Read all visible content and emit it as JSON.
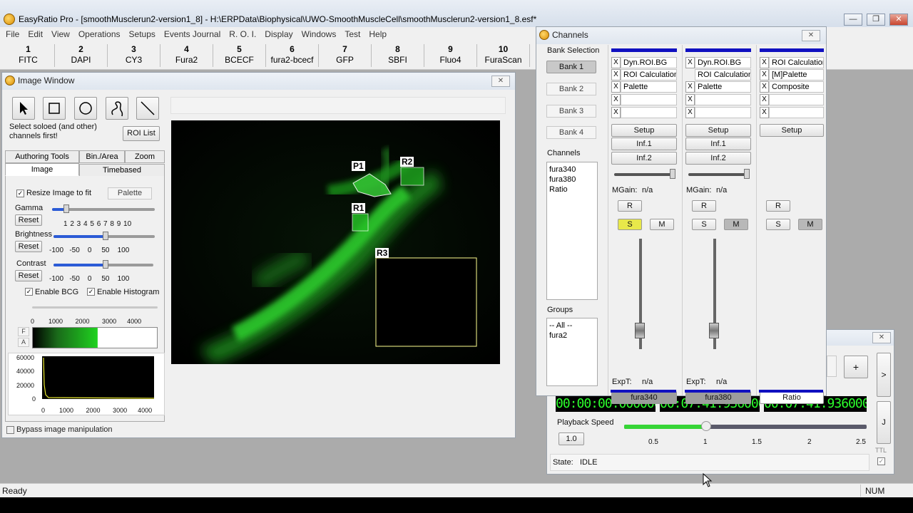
{
  "app": {
    "title": "EasyRatio Pro - [smoothMusclerun2-version1_8] - H:\\ERPData\\Biophysical\\UWO-SmoothMuscleCell\\smoothMusclerun2-version1_8.esf*",
    "window_controls": [
      "—",
      "❐",
      "✕"
    ]
  },
  "menu": [
    "File",
    "Edit",
    "View",
    "Operations",
    "Setups",
    "Events Journal",
    "R. O. I.",
    "Display",
    "Windows",
    "Test",
    "Help"
  ],
  "toolbar": [
    {
      "num": "1",
      "name": "FITC"
    },
    {
      "num": "2",
      "name": "DAPI"
    },
    {
      "num": "3",
      "name": "CY3"
    },
    {
      "num": "4",
      "name": "Fura2"
    },
    {
      "num": "5",
      "name": "BCECF"
    },
    {
      "num": "6",
      "name": "fura2-bcecf"
    },
    {
      "num": "7",
      "name": "GFP"
    },
    {
      "num": "8",
      "name": "SBFI"
    },
    {
      "num": "9",
      "name": "Fluo4"
    },
    {
      "num": "10",
      "name": "FuraScan"
    }
  ],
  "image_window": {
    "title": "Image Window",
    "hint": "Select soloed (and other) channels first!",
    "roi_list_label": "ROI List",
    "tabs_top": [
      "Authoring Tools",
      "Bin./Area",
      "Zoom"
    ],
    "tabs_bottom": [
      "Image",
      "Timebased"
    ],
    "resize_label": "Resize Image to fit",
    "palette_label": "Palette",
    "gamma_label": "Gamma",
    "gamma_ticks": "1  2  3  4  5  6  7  8  9  10",
    "brightness_label": "Brightness",
    "brightness_ticks": "-100   -50    0     50    100",
    "contrast_label": "Contrast",
    "contrast_ticks": "-100   -50    0     50    100",
    "reset_label": "Reset",
    "enable_bcg": "Enable BCG",
    "enable_histogram": "Enable Histogram",
    "range_ticks": "0        1000       2000       3000      4000",
    "f_label": "F",
    "a_label": "A",
    "hist_y": [
      "60000",
      "40000",
      "20000",
      "0"
    ],
    "hist_x": "0        1000       2000       3000      4000",
    "bypass_label": "Bypass image manipulation",
    "rois": [
      "P1",
      "R2",
      "R1",
      "R3"
    ]
  },
  "channels": {
    "title": "Channels",
    "bank_selection": "Bank Selection",
    "banks": [
      "Bank 1",
      "Bank 2",
      "Bank 3",
      "Bank 4"
    ],
    "channels_label": "Channels",
    "channel_list": [
      "fura340",
      "fura380",
      "Ratio"
    ],
    "groups_label": "Groups",
    "group_list": [
      "-- All --",
      "fura2"
    ],
    "strips": [
      {
        "slots": [
          "Dyn.ROI.BG",
          "ROI Calculation",
          "Palette",
          "",
          ""
        ],
        "setup": "Setup",
        "inf1": "Inf.1",
        "inf2": "Inf.2",
        "mgain_label": "MGain:",
        "mgain": "n/a",
        "r": "R",
        "s": "S",
        "m": "M",
        "expt_label": "ExpT:",
        "expt": "n/a",
        "name": "fura340"
      },
      {
        "slots": [
          "Dyn.ROI.BG",
          "ROI Calculation",
          "Palette",
          "",
          ""
        ],
        "setup": "Setup",
        "inf1": "Inf.1",
        "inf2": "Inf.2",
        "mgain_label": "MGain:",
        "mgain": "n/a",
        "r": "R",
        "s": "S",
        "m": "M",
        "expt_label": "ExpT:",
        "expt": "n/a",
        "name": "fura380"
      },
      {
        "slots": [
          "ROI Calculation",
          "[M]Palette",
          "Composite",
          "",
          ""
        ],
        "setup": "Setup",
        "r": "R",
        "s": "S",
        "m": "M",
        "name": "Ratio"
      }
    ]
  },
  "playback": {
    "lcd": [
      "00:00:00.000000",
      "00:07:41.936000",
      "00:07:41.936000"
    ],
    "speed_label": "Playback Speed",
    "speed_value": "1.0",
    "speed_ticks": [
      "0.5",
      "1",
      "1.5",
      "2",
      "2.5"
    ],
    "state_label": "State:",
    "state": "IDLE",
    "plus": "+",
    "next": ">",
    "j": "J",
    "ttl": "TTL"
  },
  "status": {
    "left": "Ready",
    "right": "NUM"
  }
}
